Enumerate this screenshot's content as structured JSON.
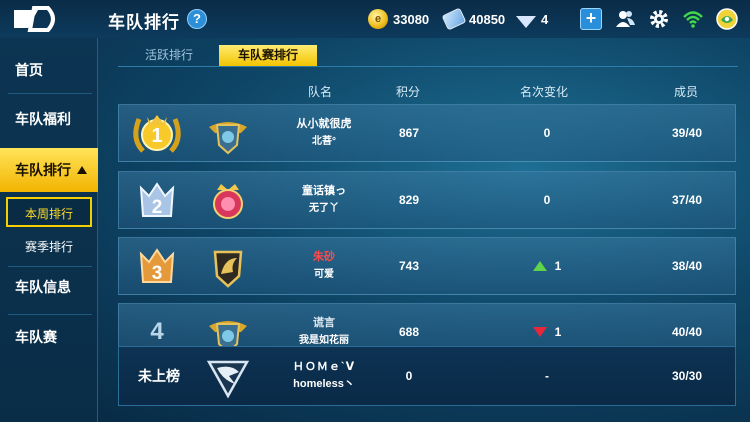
{
  "header": {
    "title": "车队排行",
    "help_label": "?",
    "coins": "33080",
    "tickets": "40850",
    "diamonds": "4",
    "icons": [
      "logo-icon",
      "coin-icon",
      "ticket-icon",
      "diamond-icon",
      "add-icon",
      "friends-icon",
      "gear-icon",
      "wifi-icon",
      "avatar-icon"
    ]
  },
  "sidebar": {
    "items": [
      {
        "label": "首页"
      },
      {
        "label": "车队福利"
      },
      {
        "label": "车队排行"
      },
      {
        "label": "车队信息"
      },
      {
        "label": "车队赛"
      }
    ],
    "sub_items": [
      {
        "label": "本周排行"
      },
      {
        "label": "赛季排行"
      }
    ]
  },
  "tabs": [
    {
      "label": "活跃排行"
    },
    {
      "label": "车队赛排行"
    }
  ],
  "table": {
    "headers": {
      "name": "队名",
      "score": "积分",
      "change": "名次变化",
      "members": "成员"
    },
    "rows": [
      {
        "rank": "1",
        "team": "从小就很虎",
        "captain": "北菩°",
        "score": "867",
        "change": "0",
        "members": "39/40"
      },
      {
        "rank": "2",
        "team": "童话镇っ",
        "captain": "无了丫",
        "score": "829",
        "change": "0",
        "members": "37/40"
      },
      {
        "rank": "3",
        "team": "朱砂",
        "captain": "可爱",
        "score": "743",
        "change": "1",
        "members": "38/40"
      },
      {
        "rank": "4",
        "team": "谎言",
        "captain": "我是如花丽",
        "score": "688",
        "change": "1",
        "members": "40/40"
      }
    ],
    "my_team": {
      "rank_label": "未上榜",
      "team": "ＨＯＭｅ`ᐯ",
      "captain": "homeless丶",
      "score": "0",
      "change": "-",
      "members": "30/30"
    }
  },
  "colors": {
    "accent": "#f5c800",
    "rank3_name": "#ff4a4a",
    "change_up": "#5fd34a",
    "change_down": "#e8283a"
  }
}
